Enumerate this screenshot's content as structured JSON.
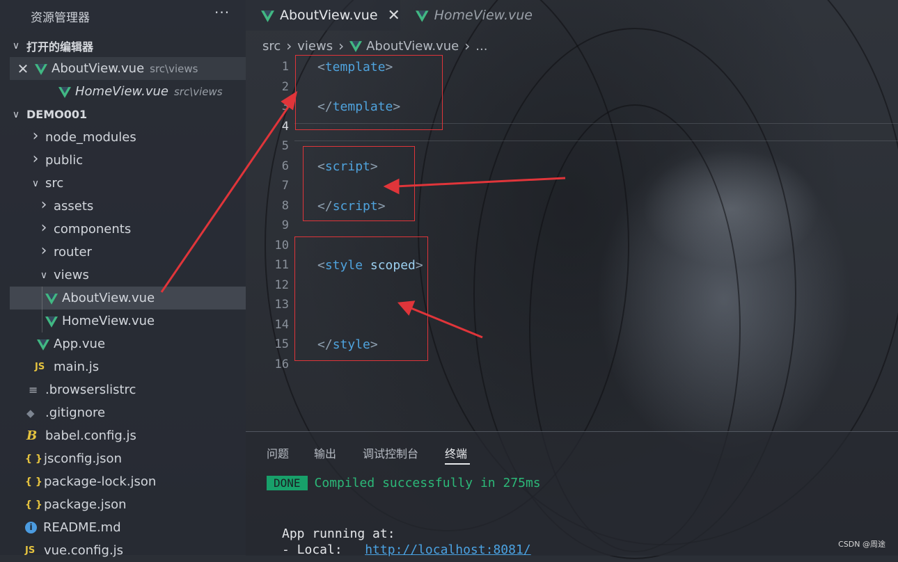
{
  "explorer": {
    "title": "资源管理器",
    "more": "···",
    "open_editors_label": "打开的编辑器",
    "open_editors": [
      {
        "name": "AboutView.vue",
        "path": "src\\views"
      },
      {
        "name": "HomeView.vue",
        "path": "src\\views"
      }
    ],
    "project_label": "DEMO001",
    "tree": {
      "node_modules": "node_modules",
      "public": "public",
      "src": "src",
      "assets": "assets",
      "components": "components",
      "router": "router",
      "views": "views",
      "about": "AboutView.vue",
      "home": "HomeView.vue",
      "app": "App.vue",
      "main": "main.js",
      "browserslistrc": ".browserslistrc",
      "gitignore": ".gitignore",
      "babel": "babel.config.js",
      "jsconfig": "jsconfig.json",
      "package_lock": "package-lock.json",
      "package": "package.json",
      "readme": "README.md",
      "vue_config": "vue.config.js"
    },
    "icons": {
      "js": "JS",
      "json": "{ }",
      "babel": "B",
      "info": "i"
    }
  },
  "tabs": [
    {
      "label": "AboutView.vue",
      "active": true,
      "close": "✕"
    },
    {
      "label": "HomeView.vue",
      "active": false
    }
  ],
  "breadcrumb": {
    "seg1": "src",
    "seg2": "views",
    "seg3": "AboutView.vue",
    "seg4": "..."
  },
  "editor": {
    "line_numbers": [
      "1",
      "2",
      "3",
      "4",
      "5",
      "6",
      "7",
      "8",
      "9",
      "10",
      "11",
      "12",
      "13",
      "14",
      "15",
      "16"
    ],
    "code": {
      "template_open": "template",
      "template_close": "template",
      "script_open": "script",
      "script_close": "script",
      "style_open": "style",
      "style_attr": "scoped",
      "style_close": "style"
    }
  },
  "panel": {
    "tabs": [
      "问题",
      "输出",
      "调试控制台",
      "终端"
    ],
    "active_tab": "终端",
    "terminal": {
      "badge": "DONE",
      "compiled": "Compiled successfully in 275ms",
      "running": "App running at:",
      "local_label": "- Local:",
      "local_url": "http://localhost:8081/"
    }
  },
  "colors": {
    "vue_green": "#41b883",
    "annotation_red": "#e0353a",
    "done_badge": "#18a06a"
  },
  "watermark": "CSDN @周途"
}
